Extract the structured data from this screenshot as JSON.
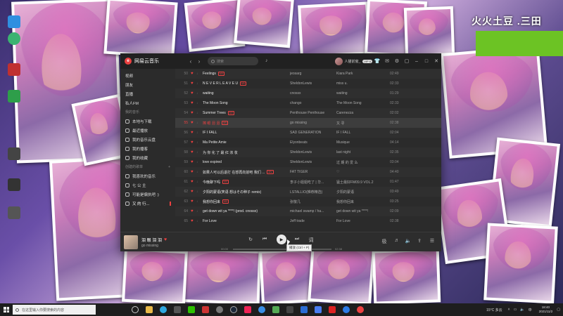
{
  "app": {
    "title": "网易云音乐",
    "search_placeholder": "搜索",
    "user_name": "人猫前窗_",
    "vip_label": "VIP 6",
    "accent": "#ec4141"
  },
  "sidebar": {
    "items_top": [
      "视频",
      "朋友",
      "直播",
      "私人FM"
    ],
    "section_my_music": "我的音乐",
    "my_music_items": [
      "本地与下载",
      "最近播放",
      "我的音乐云盘",
      "我的播客",
      "我的收藏"
    ],
    "section_playlists": "创建的歌单",
    "playlists": [
      "我喜欢的音乐",
      "七 公 主",
      "可能是偏执吧 :)",
      "又 的 行..."
    ]
  },
  "tracks": [
    {
      "num": "50",
      "title": "Feelings",
      "badge": "MV",
      "artist": "jeosarg",
      "album": "Kiara Park",
      "duration": "02:49"
    },
    {
      "num": "51",
      "title": "N E V E R L E A V E U",
      "badge": "MV",
      "artist": "SheldonLewis",
      "album": "miss u.",
      "duration": "02:33"
    },
    {
      "num": "52",
      "title": "waiting",
      "badge": "",
      "artist": "cnossx",
      "album": "waiting",
      "duration": "01:29"
    },
    {
      "num": "53",
      "title": "The Moon Song",
      "badge": "",
      "artist": "chango",
      "album": "The Moon Song",
      "duration": "02:33"
    },
    {
      "num": "54",
      "title": "Summer Trees",
      "badge": "MV",
      "artist": "Penthouse Penthouse",
      "album": "Carenezza",
      "duration": "02:02"
    },
    {
      "num": "55",
      "title": "擦 眼 泪 泪",
      "badge": "MV",
      "artist": "go missing",
      "album": "又 寻",
      "duration": "02:38",
      "active": true
    },
    {
      "num": "56",
      "title": "IF I FALL",
      "badge": "",
      "artist": "SAD GENERATION",
      "album": "IF I FALL",
      "duration": "02:04"
    },
    {
      "num": "57",
      "title": "Ma Petite Amie",
      "badge": "",
      "artist": "Elyonbeats",
      "album": "Musique",
      "duration": "04:14"
    },
    {
      "num": "58",
      "title": "为 你 化 了 最 红 浓 妆",
      "badge": "",
      "artist": "SheldonLewis",
      "album": "last night",
      "duration": "02:35"
    },
    {
      "num": "59",
      "title": "love expired",
      "badge": "",
      "artist": "SheldonLewis",
      "album": "过 期 的 爱 么",
      "duration": "03:04"
    },
    {
      "num": "60",
      "title": "如果人可以后退打 在想再向前吧 我们 ...",
      "badge": "MV",
      "artist": "FAT TIGER",
      "album": "♡",
      "duration": "04:40"
    },
    {
      "num": "61",
      "title": "今晚聊下吗",
      "badge": "MV",
      "artist": "李子小姐姐吃了 | 华...",
      "album": "猛士最好FM09.9 VOL.2",
      "duration": "01:47"
    },
    {
      "num": "62",
      "title": "夕阳的蒙语(笑语 想はその种子 remix)",
      "badge": "",
      "artist": "LSTALLIO(推荐精选)",
      "album": "夕阳的蒙语",
      "duration": "03:49"
    },
    {
      "num": "63",
      "title": "我想你回来",
      "badge": "MV",
      "artist": "张敬几",
      "album": "我想你回来",
      "duration": "03:25"
    },
    {
      "num": "64",
      "title": "get down wit ya ****! (prod. cnossx)",
      "badge": "",
      "artist": "michael swamp / ha...",
      "album": "get down wit ya ****!",
      "duration": "02:09"
    },
    {
      "num": "65",
      "title": "For Love",
      "badge": "",
      "artist": "Jeff trade",
      "album": "For Love",
      "duration": "02:38"
    }
  ],
  "player": {
    "now_title": "泪 眼 泪 泪",
    "now_artist": "go missing",
    "time_current": "00:00",
    "time_total": "02:38",
    "progress": 0.0,
    "tooltip": "播放 (Ctrl + P)"
  },
  "desktop": {
    "watermark": "火火土豆 .三田",
    "icons": [
      "",
      "",
      "",
      "",
      "",
      "",
      "",
      ""
    ]
  },
  "taskbar": {
    "search_placeholder": "在这里输入你要搜索的内容",
    "weather": "15°C 多云",
    "time": "18:40",
    "date": "2021/11/2"
  }
}
